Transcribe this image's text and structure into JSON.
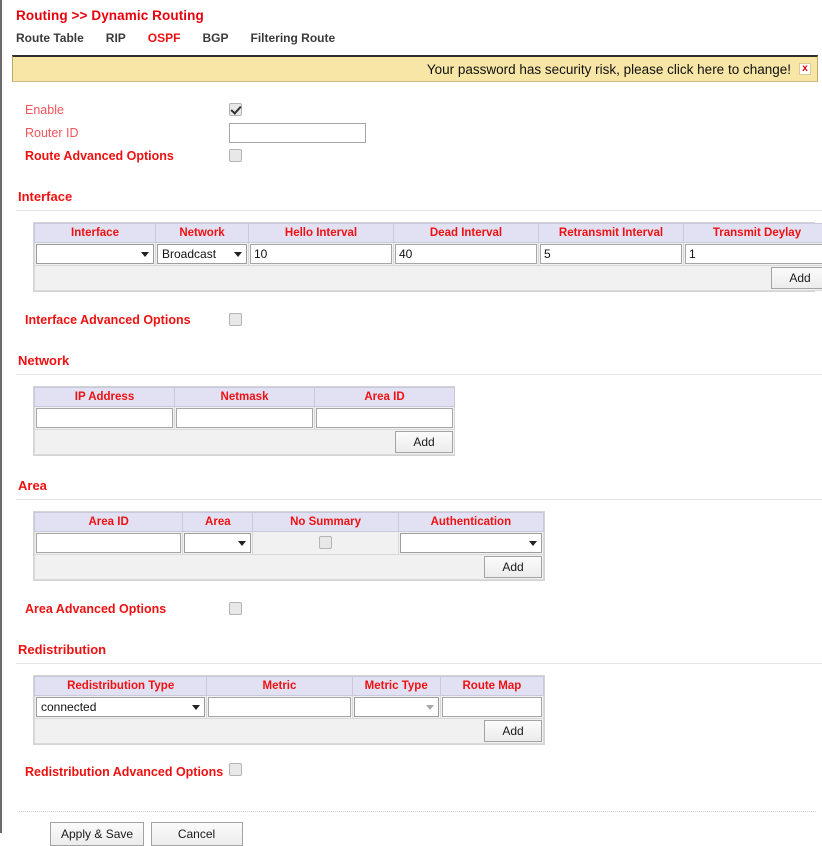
{
  "breadcrumb": "Routing >> Dynamic Routing",
  "tabs": [
    {
      "label": "Route Table",
      "active": false
    },
    {
      "label": "RIP",
      "active": false
    },
    {
      "label": "OSPF",
      "active": true
    },
    {
      "label": "BGP",
      "active": false
    },
    {
      "label": "Filtering Route",
      "active": false
    }
  ],
  "banner": {
    "text": "Your password has security risk, please click here to change!",
    "close_label": "x",
    "background": "#f7e6a6"
  },
  "general": {
    "enable_label": "Enable",
    "enable_checked": true,
    "router_id_label": "Router ID",
    "router_id_value": "",
    "route_advanced_label": "Route Advanced Options",
    "route_advanced_checked": false
  },
  "interface_section": {
    "heading": "Interface",
    "headers": [
      "Interface",
      "Network",
      "Hello Interval",
      "Dead Interval",
      "Retransmit Interval",
      "Transmit Deylay"
    ],
    "row": {
      "interface": "",
      "network": "Broadcast",
      "hello_interval": "10",
      "dead_interval": "40",
      "retransmit_interval": "5",
      "transmit_delay": "1"
    },
    "add_label": "Add",
    "advanced_label": "Interface Advanced Options",
    "advanced_checked": false
  },
  "network_section": {
    "heading": "Network",
    "headers": [
      "IP Address",
      "Netmask",
      "Area ID"
    ],
    "row": {
      "ip_address": "",
      "netmask": "",
      "area_id": ""
    },
    "add_label": "Add"
  },
  "area_section": {
    "heading": "Area",
    "headers": [
      "Area ID",
      "Area",
      "No Summary",
      "Authentication"
    ],
    "row": {
      "area_id": "",
      "area": "",
      "no_summary_checked": false,
      "authentication": ""
    },
    "add_label": "Add",
    "advanced_label": "Area Advanced Options",
    "advanced_checked": false
  },
  "redistribution_section": {
    "heading": "Redistribution",
    "headers": [
      "Redistribution Type",
      "Metric",
      "Metric Type",
      "Route Map"
    ],
    "row": {
      "type": "connected",
      "metric": "",
      "metric_type": "",
      "route_map": ""
    },
    "add_label": "Add",
    "advanced_label": "Redistribution Advanced Options",
    "advanced_checked": false
  },
  "footer": {
    "apply_label": "Apply & Save",
    "cancel_label": "Cancel"
  },
  "colors": {
    "heading_red": "#ee1111",
    "label_red": "#f4545a",
    "table_header_bg": "#e2e1f4",
    "banner_bg": "#f7e6a6"
  }
}
